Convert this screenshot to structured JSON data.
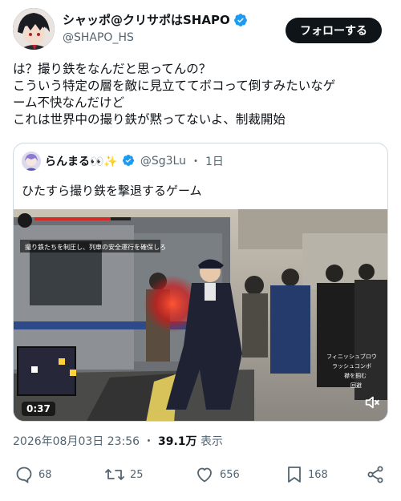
{
  "author": {
    "display_name": "シャッポ@クリサポはSHAPO",
    "handle": "@SHAPO_HS",
    "verified": true
  },
  "follow_button": "フォローする",
  "tweet_lines": [
    "は？撮り鉄をなんだと思ってんの？",
    "こういう特定の層を敵に見立ててボコって倒すみたいなゲ",
    "ーム不快なんだけど",
    "これは世界中の撮り鉄が黙ってないよ、制裁開始"
  ],
  "quoted": {
    "name": "らんまる👀✨",
    "handle": "@Sg3Lu",
    "separator": "・",
    "time": "1日",
    "text": "ひたすら撮り鉄を撃退するゲーム",
    "video": {
      "duration": "0:37",
      "hud_objective": "撮り鉄たちを制圧し、列車の安全運行を確保しろ",
      "hud_controls": [
        "フィニッシュブロウ",
        "ラッシュコンボ",
        "襟を掴む",
        "回避"
      ]
    }
  },
  "meta": {
    "timestamp": "2026年08月03日 23:56",
    "dot": "・",
    "views": "39.1万",
    "views_label": "表示"
  },
  "actions": {
    "reply_count": "68",
    "retweet_count": "25",
    "like_count": "656",
    "bookmark_count": "168"
  },
  "colors": {
    "verified": "#1d9bf0",
    "text": "#0f1419",
    "secondary": "#536471",
    "border": "#cfd9de"
  },
  "icons": [
    "verified-badge-icon",
    "reply-icon",
    "retweet-icon",
    "like-icon",
    "bookmark-icon",
    "share-icon",
    "mute-icon"
  ]
}
